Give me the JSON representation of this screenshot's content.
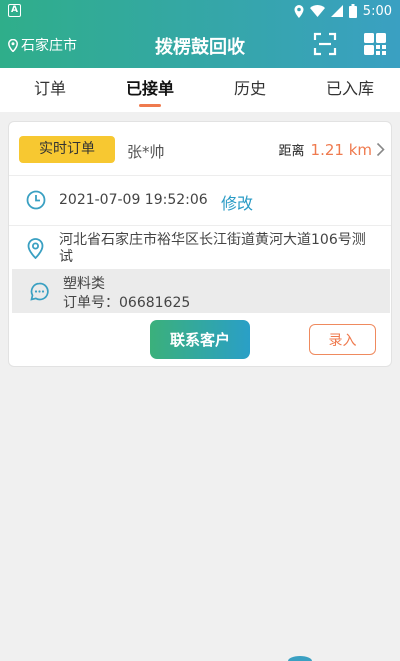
{
  "status_bar": {
    "time": "5:00",
    "notification_icon_letter": "A",
    "icons": [
      "notification-icon",
      "location-icon",
      "wifi-icon",
      "signal-icon",
      "battery-icon"
    ]
  },
  "header": {
    "location": "石家庄市",
    "title": "拨楞鼓回收",
    "icons": [
      "location-pin-icon",
      "scan-icon",
      "grid-icon"
    ],
    "gradient": [
      "#2fae8a",
      "#3aa0c2"
    ]
  },
  "tabs": [
    {
      "label": "订单",
      "active": false
    },
    {
      "label": "已接单",
      "active": true
    },
    {
      "label": "历史",
      "active": false
    },
    {
      "label": "已入库",
      "active": false
    }
  ],
  "order_card": {
    "badge": "实时订单",
    "customer_name": "张*帅",
    "distance_label": "距离",
    "distance_value": "1.21 km",
    "time": "2021-07-09 19:52:06",
    "edit_label": "修改",
    "address": "河北省石家庄市裕华区长江街道黄河大道106号测试",
    "category": "塑料类",
    "order_no_label": "订单号：",
    "order_no": "06681625",
    "contact_button": "联系客户",
    "enter_button": "录入"
  },
  "colors": {
    "accent": "#ef7a4e",
    "badge": "#f7c831",
    "link": "#2a9bc5",
    "icon": "#3aa0c2"
  }
}
